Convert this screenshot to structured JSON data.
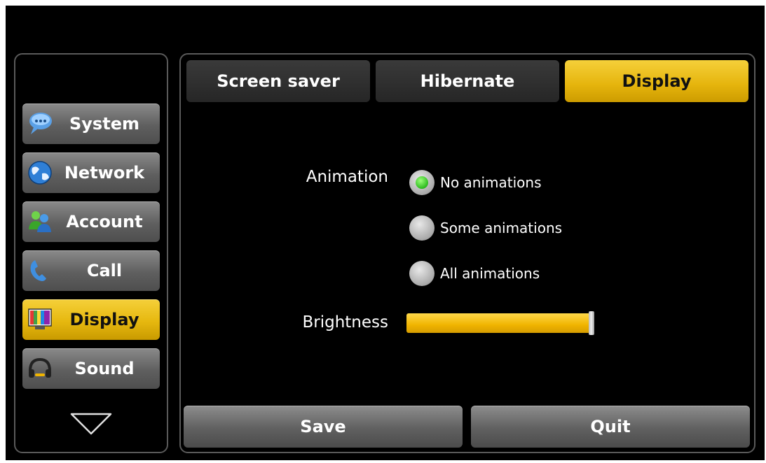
{
  "sidebar": {
    "items": [
      {
        "label": "System",
        "icon": "system-chat-bubble-icon",
        "active": false
      },
      {
        "label": "Network",
        "icon": "globe-icon",
        "active": false
      },
      {
        "label": "Account",
        "icon": "users-icon",
        "active": false
      },
      {
        "label": "Call",
        "icon": "phone-handset-icon",
        "active": false
      },
      {
        "label": "Display",
        "icon": "display-monitor-icon",
        "active": true
      },
      {
        "label": "Sound",
        "icon": "headset-icon",
        "active": false
      }
    ],
    "scroll_icon": "triangle-down-icon"
  },
  "tabs": [
    {
      "label": "Screen saver",
      "active": false
    },
    {
      "label": "Hibernate",
      "active": false
    },
    {
      "label": "Display",
      "active": true
    }
  ],
  "settings": {
    "animation_label": "Animation",
    "animation_options": [
      {
        "label": "No animations",
        "selected": true
      },
      {
        "label": "Some animations",
        "selected": false
      },
      {
        "label": "All animations",
        "selected": false
      }
    ],
    "brightness_label": "Brightness",
    "brightness_level": 1.0
  },
  "buttons": {
    "save": "Save",
    "quit": "Quit"
  },
  "colors": {
    "accent": "#e6b80f",
    "radio_selected": "#2dbb1f",
    "background": "#000000"
  }
}
